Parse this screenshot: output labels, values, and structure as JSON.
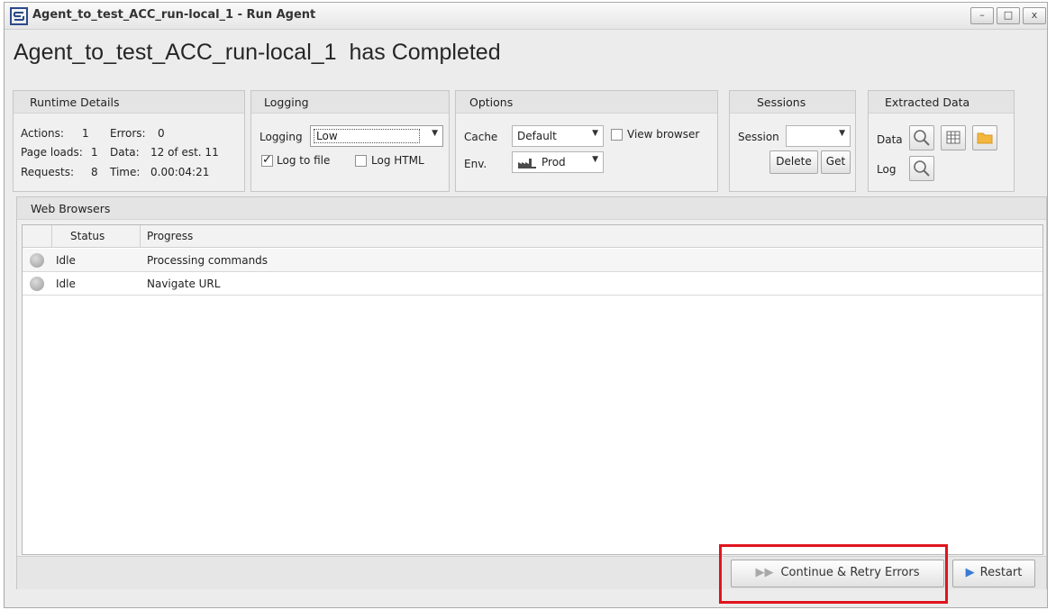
{
  "window": {
    "title": "Agent_to_test_ACC_run-local_1 - Run Agent",
    "controls": {
      "minimize": "–",
      "maximize": "□",
      "close": "x"
    }
  },
  "heading": "Agent_to_test_ACC_run-local_1  has Completed",
  "runtime": {
    "title": "Runtime Details",
    "actions_label": "Actions:",
    "actions_value": "1",
    "errors_label": "Errors:",
    "errors_value": "0",
    "pageloads_label": "Page loads:",
    "pageloads_value": "1",
    "data_label": "Data:",
    "data_value": "12 of est. 11",
    "requests_label": "Requests:",
    "requests_value": "8",
    "time_label": "Time:",
    "time_value": "0.00:04:21"
  },
  "logging": {
    "title": "Logging",
    "label": "Logging",
    "level": "Low",
    "log_to_file": "Log to file",
    "log_html": "Log HTML"
  },
  "options": {
    "title": "Options",
    "cache_label": "Cache",
    "cache_value": "Default",
    "view_browser": "View browser",
    "env_label": "Env.",
    "env_value": "Prod"
  },
  "sessions": {
    "title": "Sessions",
    "label": "Session",
    "value": "",
    "delete": "Delete",
    "get": "Get"
  },
  "extracted": {
    "title": "Extracted Data",
    "data_label": "Data",
    "log_label": "Log"
  },
  "browsers": {
    "title": "Web Browsers",
    "columns": [
      "Status",
      "Progress"
    ],
    "rows": [
      {
        "status": "Idle",
        "progress": "Processing commands"
      },
      {
        "status": "Idle",
        "progress": "Navigate URL"
      }
    ]
  },
  "actions": {
    "continue": "Continue & Retry Errors",
    "restart": "Restart"
  },
  "colors": {
    "accent_blue": "#3a7bd5",
    "highlight_red": "#e0141e"
  }
}
